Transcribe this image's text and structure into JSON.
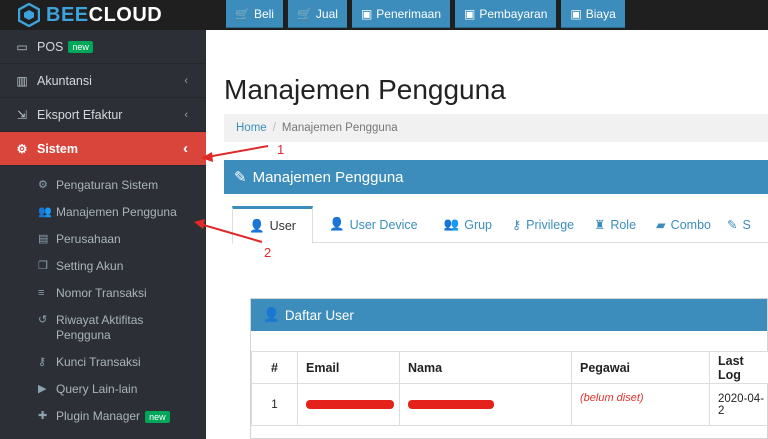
{
  "brand": {
    "name_prefix": "BEE",
    "name_suffix": "CLOUD",
    "logo_icon": "hexagon-logo-icon"
  },
  "topnav": [
    {
      "label": "Beli",
      "icon": "cart-icon"
    },
    {
      "label": "Jual",
      "icon": "cart-icon"
    },
    {
      "label": "Penerimaan",
      "icon": "money-icon"
    },
    {
      "label": "Pembayaran",
      "icon": "money-icon"
    },
    {
      "label": "Biaya",
      "icon": "money-icon"
    }
  ],
  "sidebar": {
    "items": [
      {
        "label": "POS",
        "badge": "new",
        "icon": "monitor-icon"
      },
      {
        "label": "Akuntansi",
        "icon": "bar-chart-icon"
      },
      {
        "label": "Eksport Efaktur",
        "icon": "export-icon"
      },
      {
        "label": "Sistem",
        "icon": "cogs-icon",
        "active": true
      }
    ],
    "sub_items": [
      {
        "label": "Pengaturan Sistem",
        "icon": "gear-icon"
      },
      {
        "label": "Manajemen Pengguna",
        "icon": "users-icon"
      },
      {
        "label": "Perusahaan",
        "icon": "building-icon"
      },
      {
        "label": "Setting Akun",
        "icon": "copy-icon"
      },
      {
        "label": "Nomor Transaksi",
        "icon": "list-icon"
      },
      {
        "label": "Riwayat Aktifitas Pengguna",
        "icon": "history-icon"
      },
      {
        "label": "Kunci Transaksi",
        "icon": "key-icon"
      },
      {
        "label": "Query Lain-lain",
        "icon": "play-icon"
      },
      {
        "label": "Plugin Manager",
        "badge": "new",
        "icon": "puzzle-icon"
      }
    ]
  },
  "main": {
    "title": "Manajemen Pengguna",
    "breadcrumb": {
      "home": "Home",
      "separator": "/",
      "current": "Manajemen Pengguna"
    },
    "box_title": "Manajemen Pengguna",
    "tabs": [
      {
        "label": "User",
        "icon": "user-icon",
        "active": true
      },
      {
        "label": "User Device",
        "icon": "user-icon"
      },
      {
        "label": "Grup",
        "icon": "users-icon"
      },
      {
        "label": "Privilege",
        "icon": "key-icon"
      },
      {
        "label": "Role",
        "icon": "sitemap-icon"
      },
      {
        "label": "Combo",
        "icon": "book-icon"
      },
      {
        "label": "S",
        "icon": "edit-icon"
      }
    ],
    "panel_title": "Daftar User",
    "table": {
      "headers": [
        "#",
        "Email",
        "Nama",
        "Pegawai",
        "Last Log"
      ],
      "rows": [
        {
          "num": "1",
          "pegawai": "(belum diset)",
          "last": "2020-04-2"
        }
      ]
    }
  },
  "annotations": {
    "arrow1_label": "1",
    "arrow2_label": "2"
  },
  "colors": {
    "accent": "#3c8dbc",
    "active_menu": "#d9453a",
    "sidebar_bg": "#2c3036",
    "annotation": "#e02a2a"
  }
}
